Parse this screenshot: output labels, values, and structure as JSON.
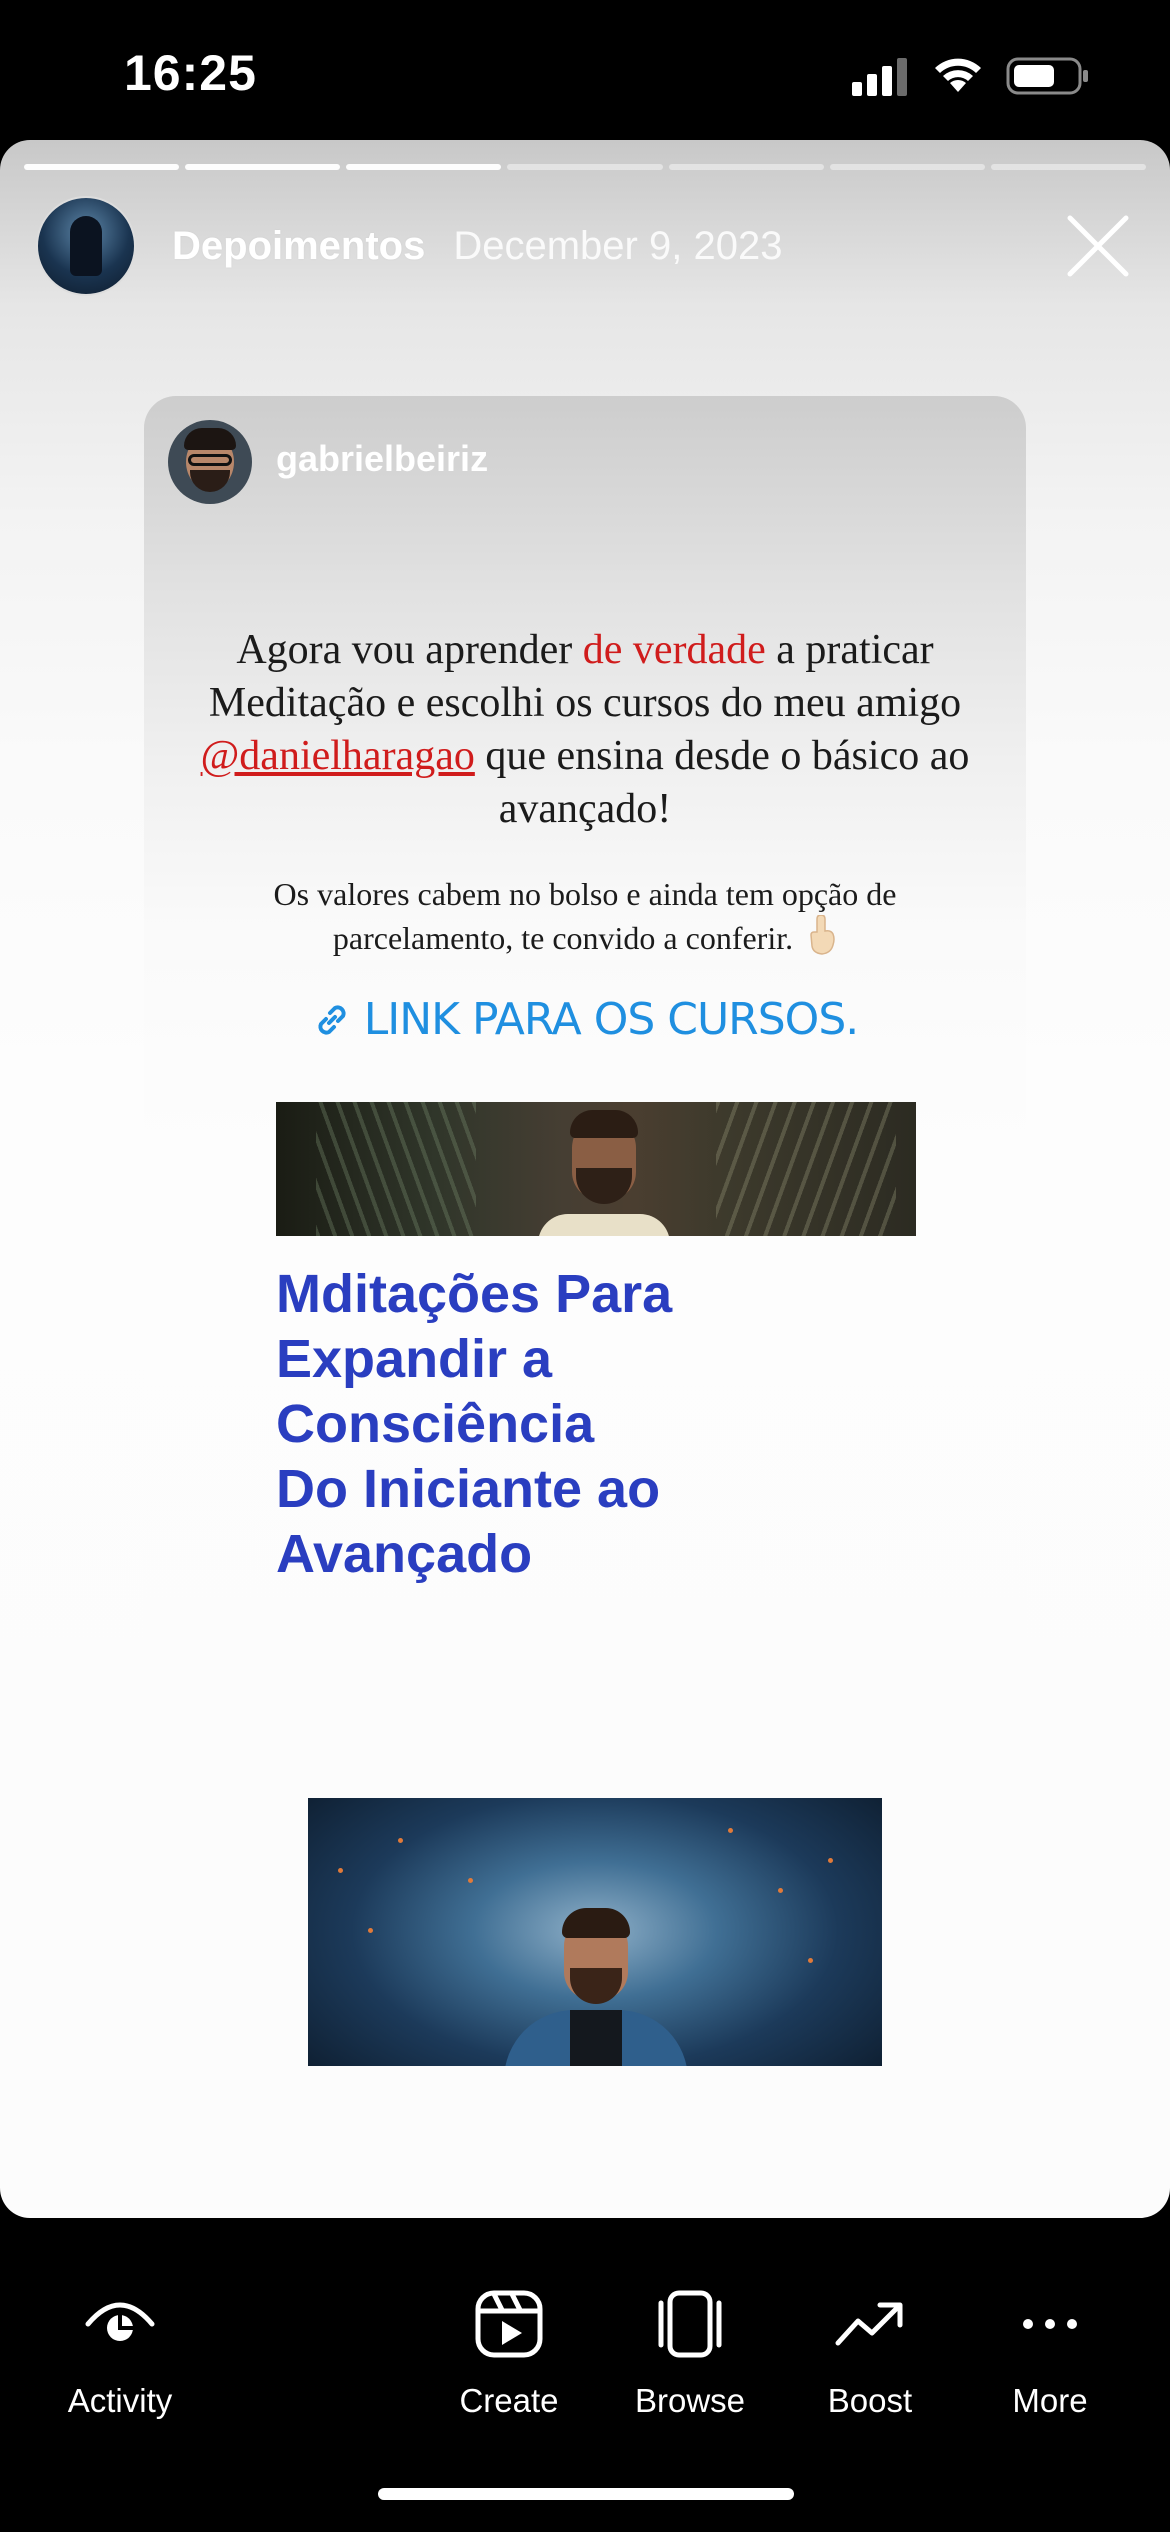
{
  "status_bar": {
    "time": "16:25"
  },
  "story": {
    "progress_segments": [
      {
        "state": "done"
      },
      {
        "state": "done"
      },
      {
        "state": "done"
      },
      {
        "state": "pending"
      },
      {
        "state": "pending"
      },
      {
        "state": "pending"
      },
      {
        "state": "pending"
      }
    ],
    "account_name": "Depoimentos",
    "date": "December 9, 2023"
  },
  "post": {
    "username": "gabrielbeiriz",
    "quote": {
      "part1": "Agora vou aprender ",
      "highlight": "de verdade",
      "part2": " a praticar Meditação e escolhi os cursos do meu amigo ",
      "mention": "@danielharagao",
      "part3": " que ensina desde o básico ao avançado!"
    },
    "note": "Os valores cabem no bolso e ainda tem opção de parcelamento, te convido a conferir.",
    "link_label": "LINK PARA OS CURSOS.",
    "course_title_lines": [
      "Mditações Para",
      "Expandir a",
      "Consciência",
      "Do Iniciante ao",
      "Avançado"
    ]
  },
  "bottom_nav": {
    "items": [
      {
        "label": "Activity",
        "icon": "activity-eye-icon"
      },
      {
        "label": "Create",
        "icon": "reels-create-icon"
      },
      {
        "label": "Browse",
        "icon": "browse-cards-icon"
      },
      {
        "label": "Boost",
        "icon": "boost-trend-icon"
      },
      {
        "label": "More",
        "icon": "more-dots-icon"
      }
    ]
  },
  "colors": {
    "background": "#000000",
    "mention_red": "#d01c1c",
    "link_blue": "#1f8fe0",
    "course_title_blue": "#2a3ec0"
  }
}
